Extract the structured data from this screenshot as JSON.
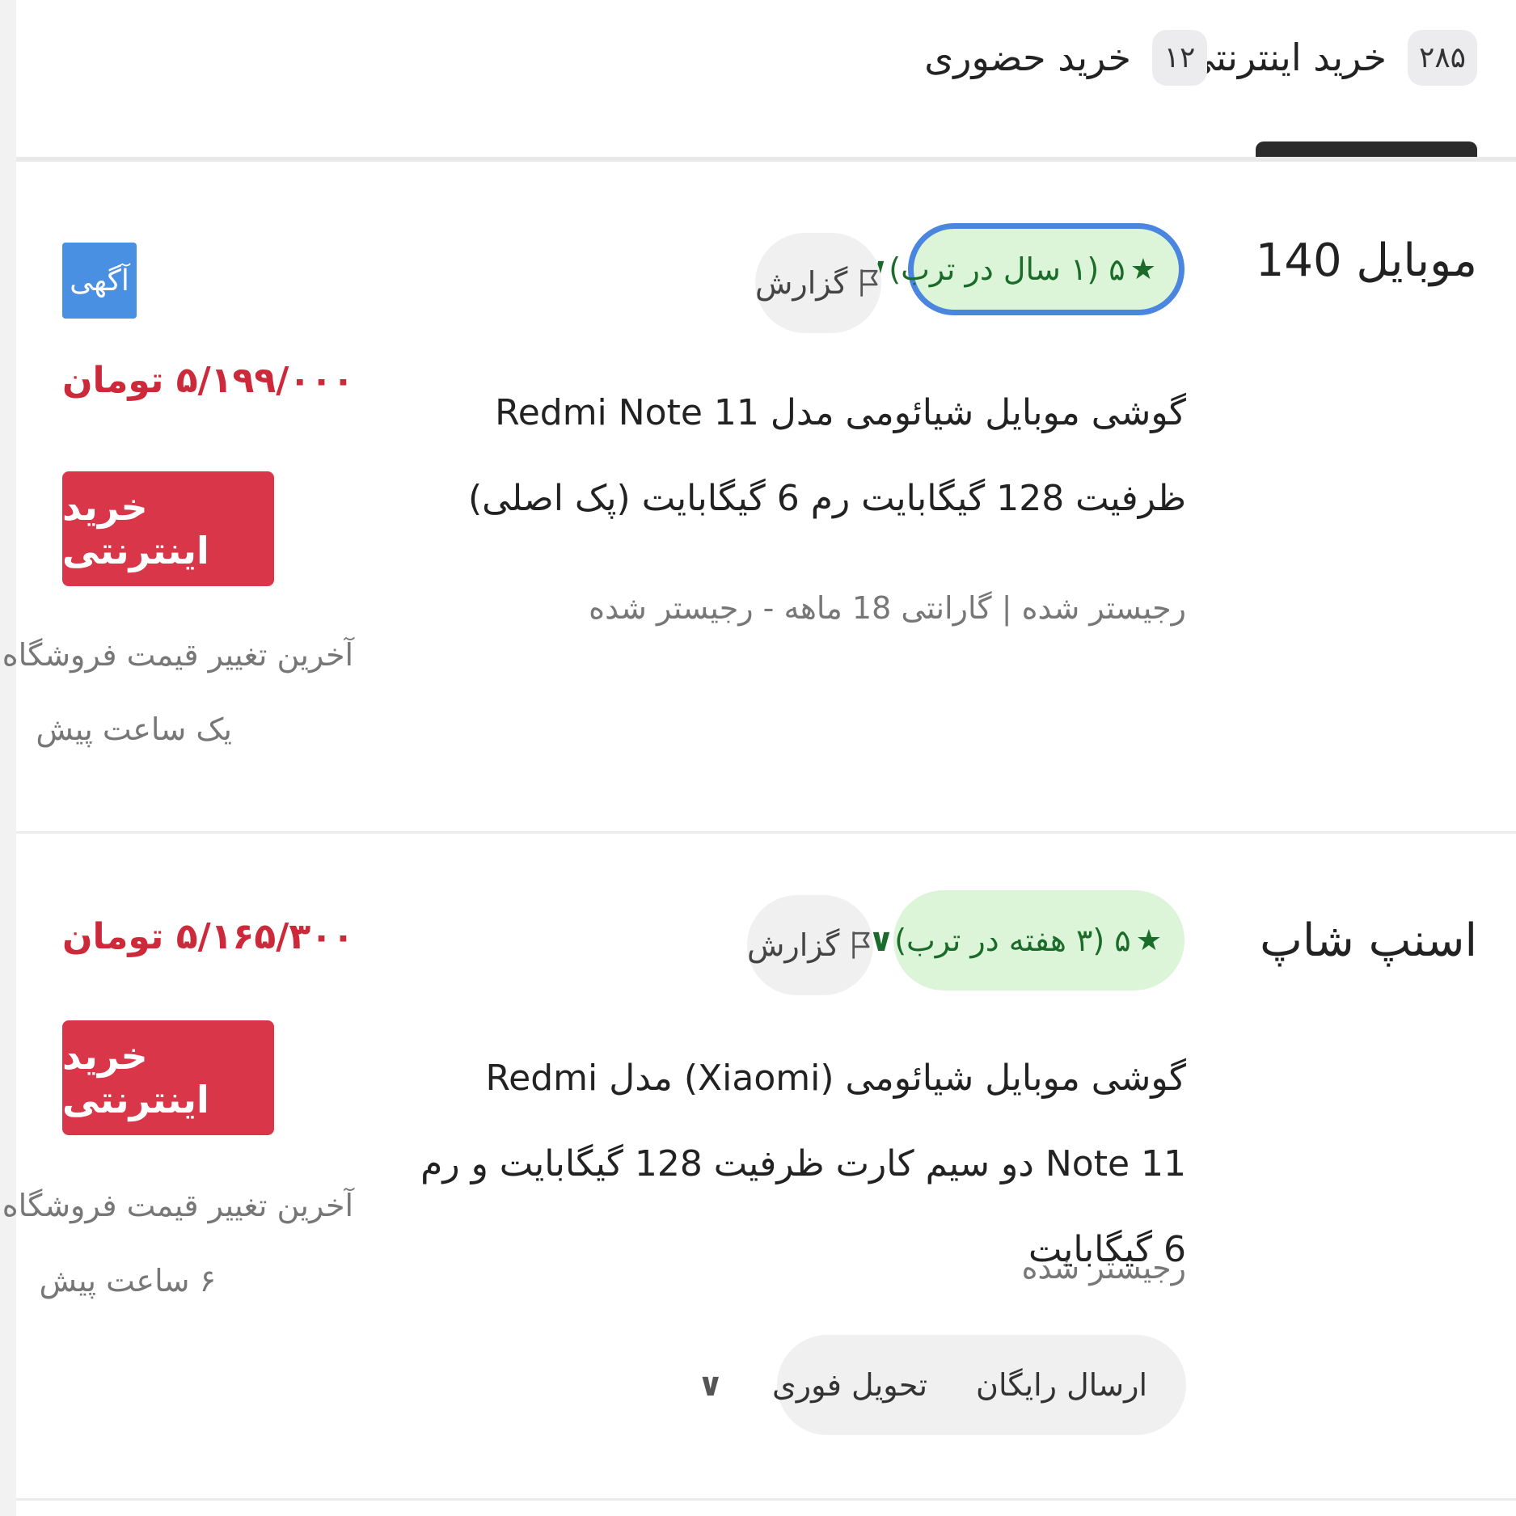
{
  "tabs": [
    {
      "label": "خرید اینترنتی",
      "count": "۲۸۵",
      "active": true
    },
    {
      "label": "خرید حضوری",
      "count": "۱۲",
      "active": false
    }
  ],
  "offers": [
    {
      "shop_name": "موبایل 140",
      "rating_text": "۵ (۱ سال در ترب)",
      "report_label": "گزارش",
      "ad_badge": "آگهی",
      "price": "۵/۱۹۹/۰۰۰ تومان",
      "buy_label": "خرید اینترنتی",
      "price_change_label": "آخرین تغییر قیمت فروشگاه:",
      "price_change_time": "یک ساعت پیش",
      "product_title": "گوشی موبایل شیائومی مدل Redmi Note 11 ظرفیت 128 گیگابایت رم 6 گیگابایت (پک اصلی)",
      "product_meta": "رجیستر شده | گارانتی 18 ماهه - رجیستر شده"
    },
    {
      "shop_name": "اسنپ شاپ",
      "rating_text": "۵ (۳ هفته در ترب)",
      "report_label": "گزارش",
      "price": "۵/۱۶۵/۳۰۰ تومان",
      "buy_label": "خرید اینترنتی",
      "price_change_label": "آخرین تغییر قیمت فروشگاه:",
      "price_change_time": "۶ ساعت پیش",
      "product_title": "گوشی موبایل شیائومی (Xiaomi) مدل Redmi Note 11 دو سیم کارت ظرفیت 128 گیگابایت و رم 6 گیگابایت",
      "product_meta": "رجیستر شده",
      "delivery": [
        "ارسال رایگان",
        "تحویل فوری"
      ]
    }
  ],
  "colors": {
    "accent_red": "#d9364a",
    "price_red": "#cc2a3a",
    "rating_green_bg": "#dcf5d8",
    "rating_green_text": "#1b6b2a",
    "focus_blue": "#4a86df",
    "ad_blue": "#4a90e2"
  },
  "icons": {
    "star": "star-icon",
    "chevron": "chevron-down-icon",
    "flag": "flag-icon"
  }
}
